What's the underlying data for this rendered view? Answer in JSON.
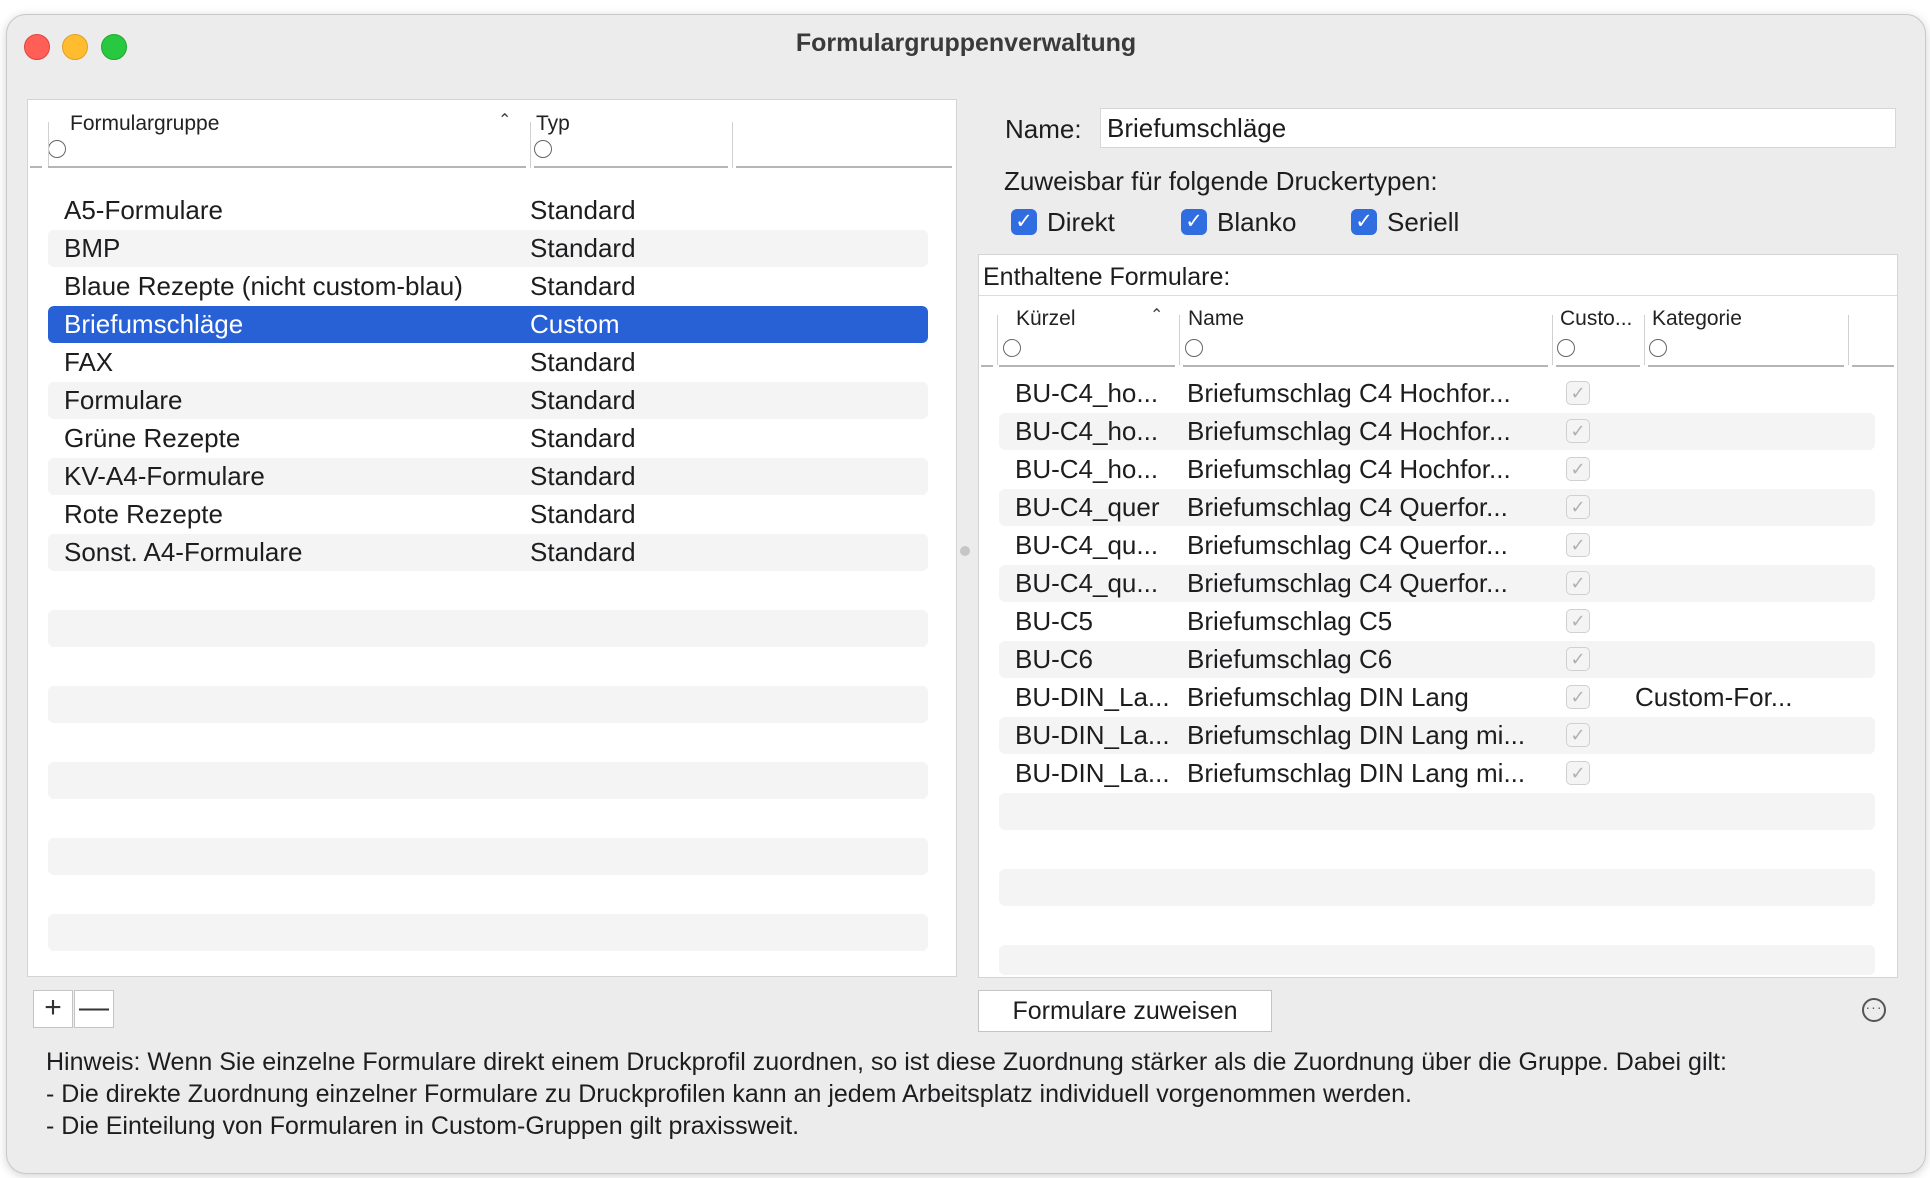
{
  "window": {
    "title": "Formulargruppenverwaltung"
  },
  "groups_table": {
    "columns": [
      "Formulargruppe",
      "Typ"
    ],
    "rows": [
      {
        "name": "A5-Formulare",
        "type": "Standard"
      },
      {
        "name": "BMP",
        "type": "Standard"
      },
      {
        "name": "Blaue Rezepte (nicht custom-blau)",
        "type": "Standard"
      },
      {
        "name": "Briefumschläge",
        "type": "Custom"
      },
      {
        "name": "FAX",
        "type": "Standard"
      },
      {
        "name": "Formulare",
        "type": "Standard"
      },
      {
        "name": "Grüne Rezepte",
        "type": "Standard"
      },
      {
        "name": "KV-A4-Formulare",
        "type": "Standard"
      },
      {
        "name": "Rote Rezepte",
        "type": "Standard"
      },
      {
        "name": "Sonst. A4-Formulare",
        "type": "Standard"
      }
    ],
    "selected_index": 3,
    "add_label": "+",
    "remove_label": "—"
  },
  "detail": {
    "name_label": "Name:",
    "name_value": "Briefumschläge",
    "printer_types_label": "Zuweisbar für folgende Druckertypen:",
    "printer_types": [
      {
        "label": "Direkt",
        "checked": true
      },
      {
        "label": "Blanko",
        "checked": true
      },
      {
        "label": "Seriell",
        "checked": true
      }
    ],
    "forms_panel_title": "Enthaltene Formulare:",
    "forms_columns": [
      "Kürzel",
      "Name",
      "Custo...",
      "Kategorie"
    ],
    "forms": [
      {
        "code": "BU-C4_ho...",
        "name": "Briefumschlag C4 Hochfor...",
        "custom": true,
        "category": ""
      },
      {
        "code": "BU-C4_ho...",
        "name": "Briefumschlag C4 Hochfor...",
        "custom": true,
        "category": ""
      },
      {
        "code": "BU-C4_ho...",
        "name": "Briefumschlag C4 Hochfor...",
        "custom": true,
        "category": ""
      },
      {
        "code": "BU-C4_quer",
        "name": "Briefumschlag C4 Querfor...",
        "custom": true,
        "category": ""
      },
      {
        "code": "BU-C4_qu...",
        "name": "Briefumschlag C4 Querfor...",
        "custom": true,
        "category": ""
      },
      {
        "code": "BU-C4_qu...",
        "name": "Briefumschlag C4 Querfor...",
        "custom": true,
        "category": ""
      },
      {
        "code": "BU-C5",
        "name": "Briefumschlag C5",
        "custom": true,
        "category": ""
      },
      {
        "code": "BU-C6",
        "name": "Briefumschlag C6",
        "custom": true,
        "category": ""
      },
      {
        "code": "BU-DIN_La...",
        "name": "Briefumschlag DIN Lang",
        "custom": true,
        "category": "Custom-For..."
      },
      {
        "code": "BU-DIN_La...",
        "name": "Briefumschlag DIN Lang mi...",
        "custom": true,
        "category": ""
      },
      {
        "code": "BU-DIN_La...",
        "name": "Briefumschlag DIN Lang mi...",
        "custom": true,
        "category": ""
      }
    ],
    "assign_button": "Formulare zuweisen",
    "more_icon": "ellipsis-circle-icon"
  },
  "hint": {
    "line1": "Hinweis: Wenn Sie einzelne Formulare direkt einem Druckprofil zuordnen, so ist diese Zuordnung stärker als die Zuordnung über die Gruppe. Dabei gilt:",
    "line2": "- Die direkte Zuordnung einzelner Formulare zu Druckprofilen kann an jedem Arbeitsplatz individuell vorgenommen werden.",
    "line3": "- Die Einteilung von Formularen in Custom-Gruppen gilt praxissweit."
  },
  "colors": {
    "selection": "#2860d6",
    "checkbox": "#2f6de1",
    "close": "#ff5f57",
    "minimize": "#febc2e",
    "maximize": "#28c840"
  }
}
